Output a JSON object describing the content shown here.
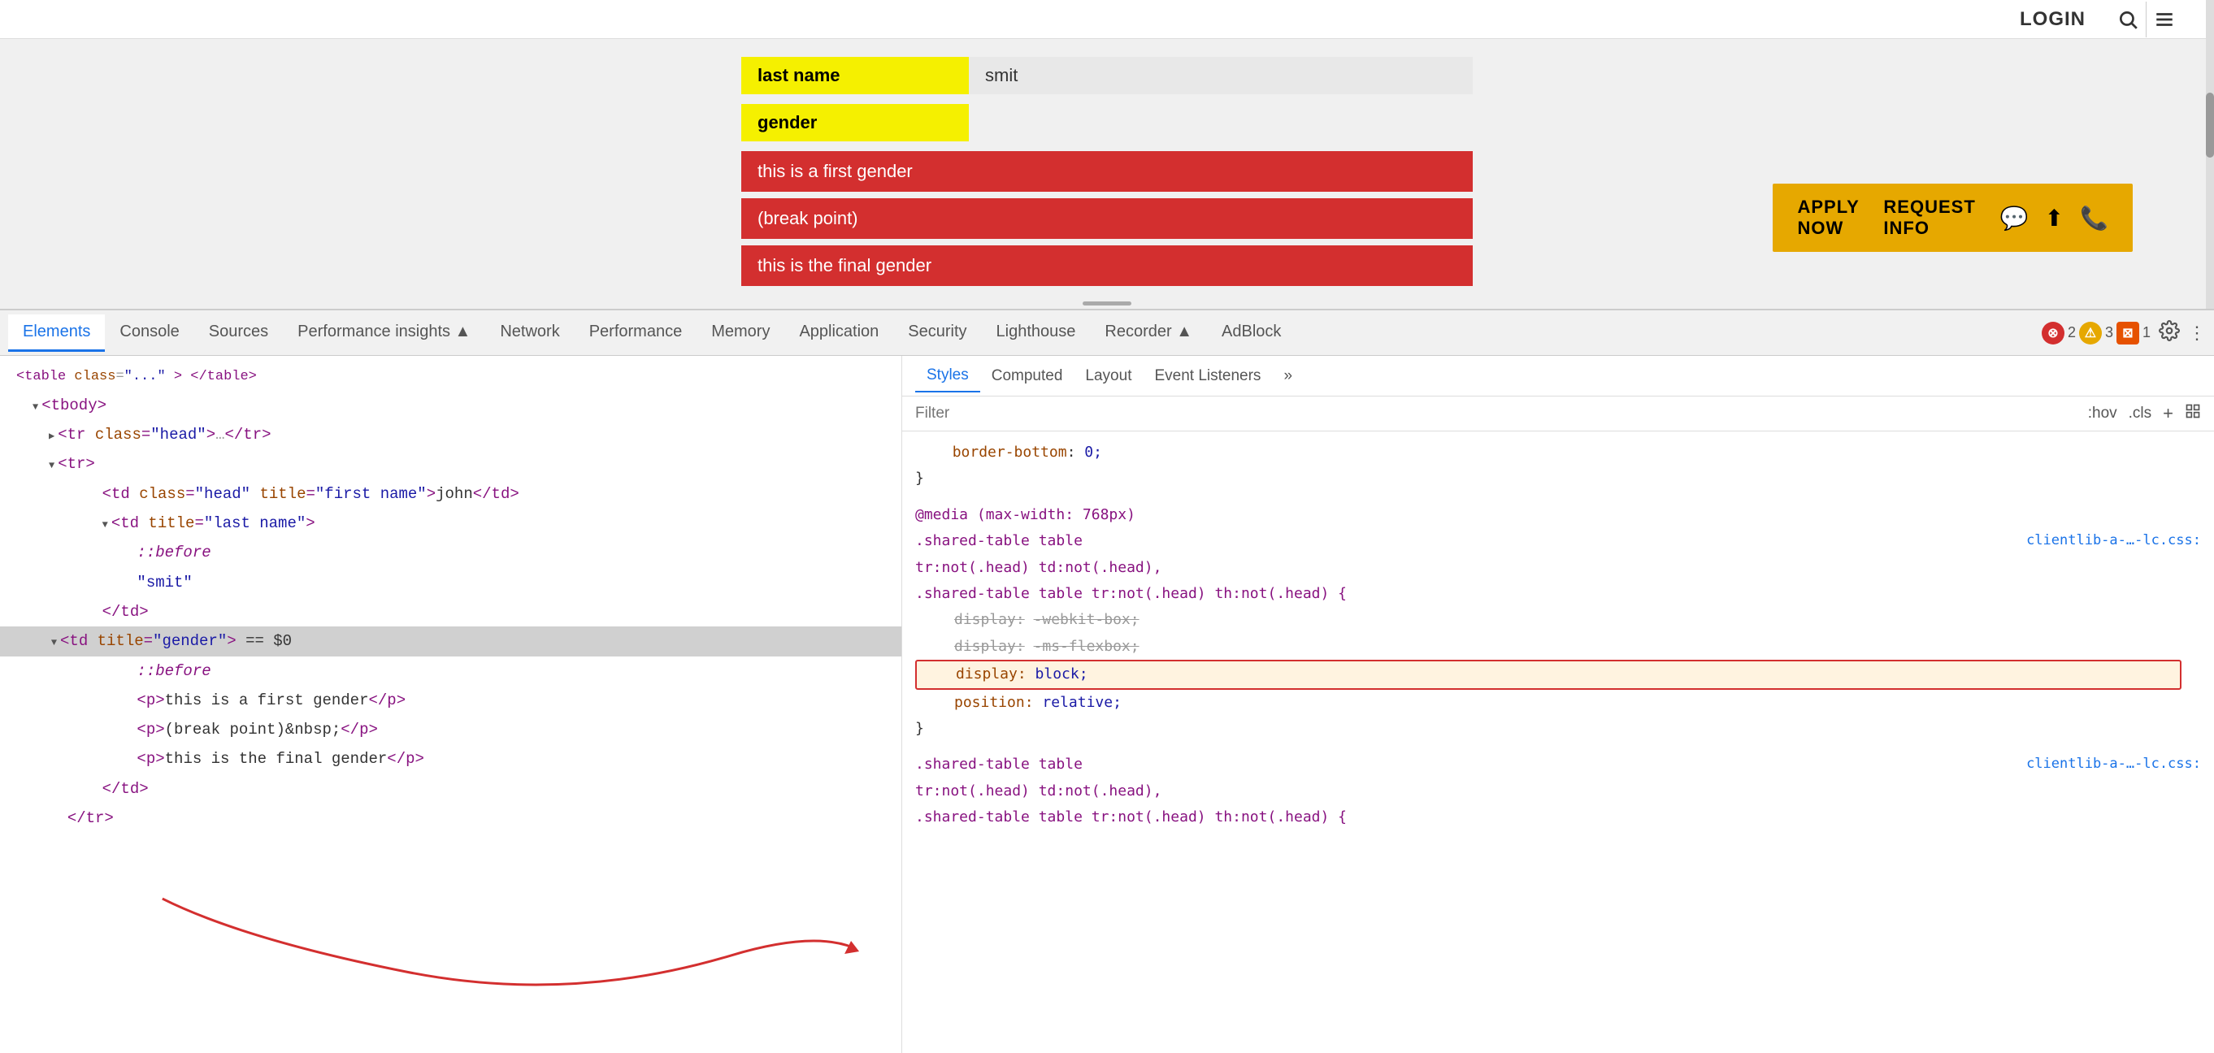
{
  "browser": {
    "nav": {
      "login_label": "LOGIN",
      "search_icon": "🔍",
      "menu_icon": "☰"
    },
    "page": {
      "last_name_label": "last name",
      "last_name_value": "smit",
      "gender_label": "gender",
      "gender_values": [
        "this is a first gender",
        "(break point)",
        "this is the final gender"
      ]
    },
    "apply_bar": {
      "apply_label": "APPLY NOW",
      "request_label": "REQUEST INFO"
    }
  },
  "devtools": {
    "tabs": [
      {
        "label": "Elements",
        "active": true
      },
      {
        "label": "Console",
        "active": false
      },
      {
        "label": "Sources",
        "active": false
      },
      {
        "label": "Performance insights ▲",
        "active": false
      },
      {
        "label": "Network",
        "active": false
      },
      {
        "label": "Performance",
        "active": false
      },
      {
        "label": "Memory",
        "active": false
      },
      {
        "label": "Application",
        "active": false
      },
      {
        "label": "Security",
        "active": false
      },
      {
        "label": "Lighthouse",
        "active": false
      },
      {
        "label": "Recorder ▲",
        "active": false
      },
      {
        "label": "AdBlock",
        "active": false
      }
    ],
    "right_badges": {
      "red_icon": "⊗",
      "red_count": "2",
      "yellow_icon": "⚠",
      "yellow_count": "3",
      "orange_icon": "⊠",
      "orange_count": "1"
    },
    "html_lines": [
      {
        "text": "<tbody>",
        "indent": 1,
        "type": "tag",
        "collapsed": false
      },
      {
        "text": "<tr class=\"head\">…</tr>",
        "indent": 2,
        "type": "collapsed"
      },
      {
        "text": "<tr>",
        "indent": 2,
        "type": "tag",
        "collapsed": false
      },
      {
        "text": "<td class=\"head\" title=\"first name\">john</td>",
        "indent": 3,
        "type": "tag"
      },
      {
        "text": "<td title=\"last name\">",
        "indent": 3,
        "type": "tag",
        "collapsed": false
      },
      {
        "text": "::before",
        "indent": 4,
        "type": "pseudo"
      },
      {
        "text": "\"smit\"",
        "indent": 4,
        "type": "string"
      },
      {
        "text": "</td>",
        "indent": 3,
        "type": "tag"
      },
      {
        "text": "<td title=\"gender\"> == $0",
        "indent": 2,
        "type": "tag",
        "selected": true
      },
      {
        "text": "::before",
        "indent": 4,
        "type": "pseudo"
      },
      {
        "text": "<p>this is a first gender</p>",
        "indent": 4,
        "type": "tag"
      },
      {
        "text": "<p>(break point)&nbsp;</p>",
        "indent": 4,
        "type": "tag"
      },
      {
        "text": "<p>this is the final gender</p>",
        "indent": 4,
        "type": "tag"
      },
      {
        "text": "</td>",
        "indent": 3,
        "type": "tag"
      },
      {
        "text": "</tr>",
        "indent": 2,
        "type": "tag"
      }
    ],
    "styles": {
      "tabs": [
        "Styles",
        "Computed",
        "Layout",
        "Event Listeners",
        "»"
      ],
      "filter_placeholder": "Filter",
      "filter_right": [
        ":hov",
        ".cls",
        "+"
      ],
      "rules": [
        {
          "selector": "border-bottom: 0;",
          "indent": true,
          "closing": "}",
          "properties": []
        },
        {
          "selector": "@media (max-width: 768px)",
          "source": "",
          "properties": []
        },
        {
          "selector": ".shared-table table",
          "source": "clientlib-a-…-lc.css:",
          "properties": []
        },
        {
          "selector": "tr:not(.head) td:not(.head),",
          "properties": []
        },
        {
          "selector": ".shared-table table tr:not(.head) th:not(.head) {",
          "properties": [
            {
              "name": "display:",
              "value": "-webkit-box;",
              "strikethrough": true
            },
            {
              "name": "display:",
              "value": "-ms-flexbox;",
              "strikethrough": true
            },
            {
              "name": "display:",
              "value": "block;",
              "highlighted": true
            },
            {
              "name": "position:",
              "value": "relative;",
              "highlighted": true
            }
          ]
        },
        {
          "closing": "}",
          "properties": []
        },
        {
          "selector": ".shared-table table",
          "source": "clientlib-a-…-lc.css:",
          "properties": []
        },
        {
          "selector": "tr:not(.head) td:not(.head),",
          "properties": []
        },
        {
          "selector": ".shared-table table tr:not(.head) th:not(.head) {",
          "properties": []
        }
      ]
    }
  }
}
